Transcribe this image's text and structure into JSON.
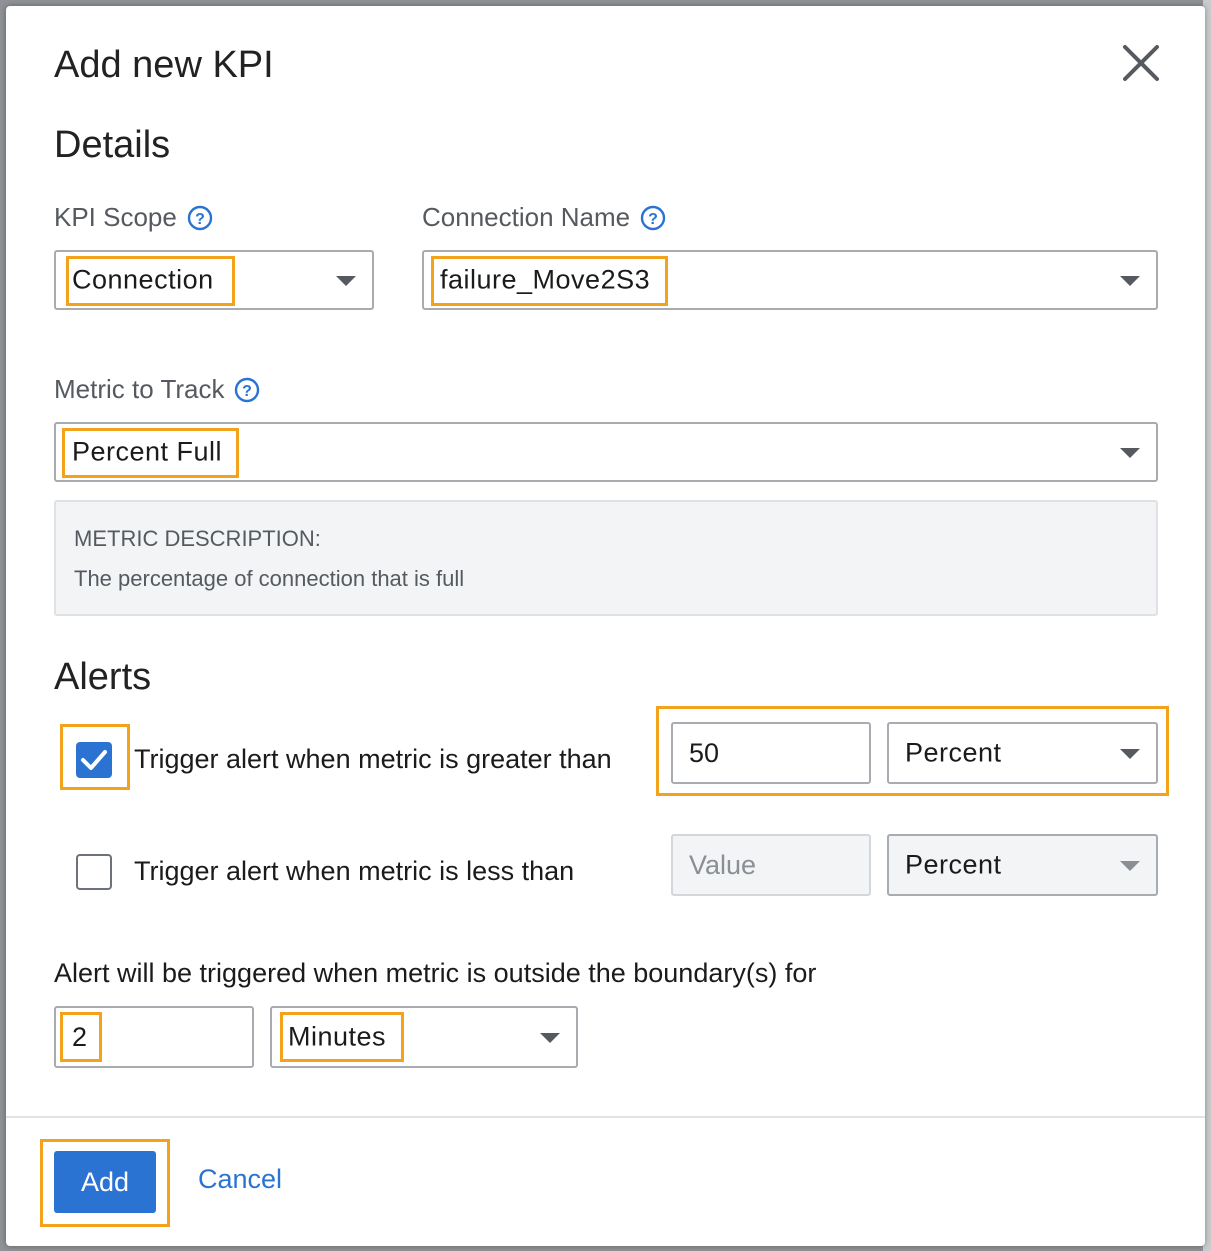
{
  "dialog": {
    "title": "Add new KPI"
  },
  "details": {
    "heading": "Details",
    "kpi_scope": {
      "label": "KPI Scope",
      "value": "Connection"
    },
    "connection_name": {
      "label": "Connection Name",
      "value": "failure_Move2S3"
    },
    "metric": {
      "label": "Metric to Track",
      "value": "Percent Full"
    },
    "metric_description": {
      "label": "METRIC DESCRIPTION:",
      "text": "The percentage of connection that is full"
    }
  },
  "alerts": {
    "heading": "Alerts",
    "greater_than": {
      "checked": true,
      "label": "Trigger alert when metric is greater than",
      "value": "50",
      "unit": "Percent"
    },
    "less_than": {
      "checked": false,
      "label": "Trigger alert when metric is less than",
      "placeholder": "Value",
      "unit": "Percent"
    },
    "boundary": {
      "label": "Alert will be triggered when metric is outside the boundary(s) for",
      "value": "2",
      "unit": "Minutes"
    }
  },
  "footer": {
    "add_label": "Add",
    "cancel_label": "Cancel"
  },
  "colors": {
    "accent": "#2b73d3",
    "highlight": "#f2a31b"
  }
}
